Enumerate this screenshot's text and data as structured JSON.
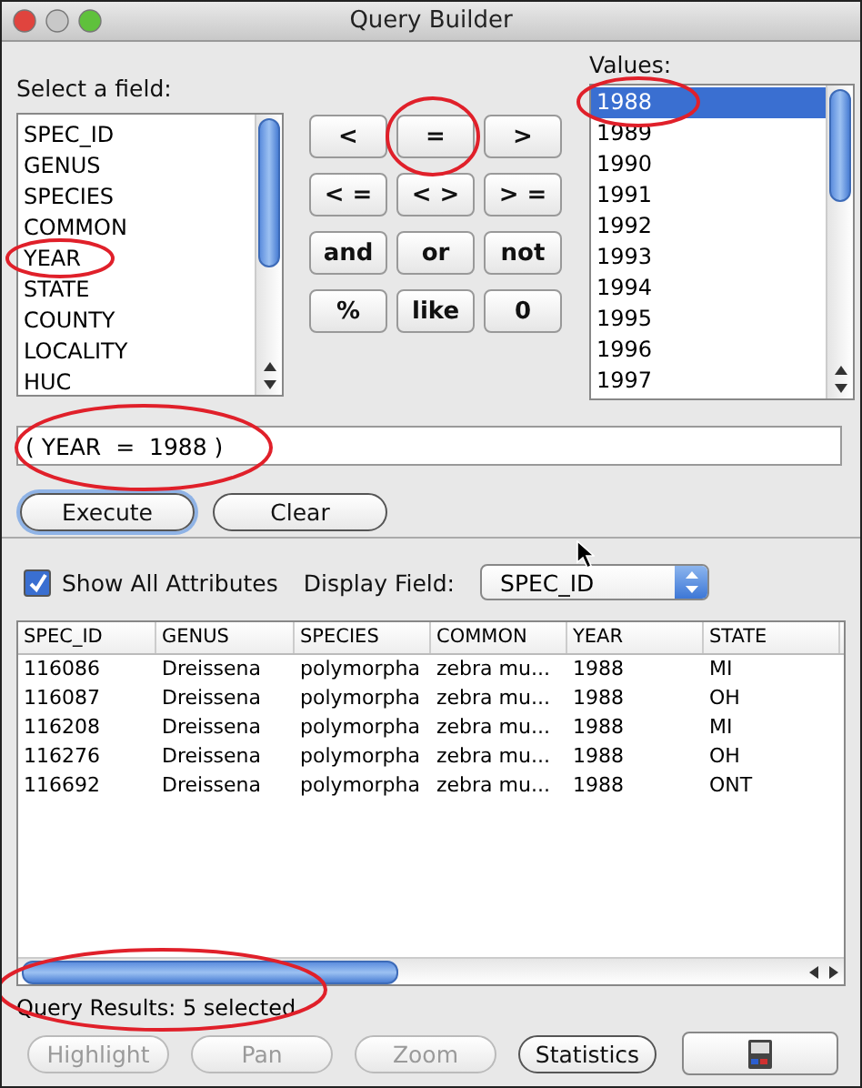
{
  "window": {
    "title": "Query Builder"
  },
  "field_list": {
    "label": "Select a field:",
    "items": [
      {
        "text": "SPEC_ID",
        "selected": false
      },
      {
        "text": "GENUS",
        "selected": false
      },
      {
        "text": "SPECIES",
        "selected": false
      },
      {
        "text": "COMMON",
        "selected": false
      },
      {
        "text": "YEAR",
        "selected": false
      },
      {
        "text": "STATE",
        "selected": false
      },
      {
        "text": "COUNTY",
        "selected": false
      },
      {
        "text": "LOCALITY",
        "selected": false
      },
      {
        "text": "HUC",
        "selected": false
      }
    ]
  },
  "operators": [
    "<",
    "=",
    ">",
    "< =",
    "< >",
    "> =",
    "and",
    "or",
    "not",
    "%",
    "like",
    "0"
  ],
  "values_list": {
    "label": "Values:",
    "items": [
      {
        "text": "1988",
        "selected": true
      },
      {
        "text": "1989",
        "selected": false
      },
      {
        "text": "1990",
        "selected": false
      },
      {
        "text": "1991",
        "selected": false
      },
      {
        "text": "1992",
        "selected": false
      },
      {
        "text": "1993",
        "selected": false
      },
      {
        "text": "1994",
        "selected": false
      },
      {
        "text": "1995",
        "selected": false
      },
      {
        "text": "1996",
        "selected": false
      },
      {
        "text": "1997",
        "selected": false
      }
    ]
  },
  "query": {
    "value": "( YEAR  =  1988 )"
  },
  "actions": [
    {
      "label": "Execute",
      "default": true
    },
    {
      "label": "Clear",
      "default": false
    }
  ],
  "show_all_attributes": {
    "label": "Show All Attributes",
    "checked": true
  },
  "display_field": {
    "label": "Display Field:",
    "value": "SPEC_ID"
  },
  "table": {
    "columns": [
      "SPEC_ID",
      "GENUS",
      "SPECIES",
      "COMMON",
      "YEAR",
      "STATE"
    ],
    "rows": [
      [
        "116086",
        "Dreissena",
        "polymorpha",
        "zebra mu...",
        "1988",
        "MI"
      ],
      [
        "116087",
        "Dreissena",
        "polymorpha",
        "zebra mu...",
        "1988",
        "OH"
      ],
      [
        "116208",
        "Dreissena",
        "polymorpha",
        "zebra mu...",
        "1988",
        "MI"
      ],
      [
        "116276",
        "Dreissena",
        "polymorpha",
        "zebra mu...",
        "1988",
        "OH"
      ],
      [
        "116692",
        "Dreissena",
        "polymorpha",
        "zebra mu...",
        "1988",
        "ONT"
      ]
    ]
  },
  "status": "Query Results: 5 selected",
  "bottom_buttons": [
    {
      "kind": "text",
      "label": "Highlight",
      "disabled": true
    },
    {
      "kind": "text",
      "label": "Pan",
      "disabled": true
    },
    {
      "kind": "text",
      "label": "Zoom",
      "disabled": true
    },
    {
      "kind": "text",
      "label": "Statistics",
      "disabled": false
    },
    {
      "kind": "save",
      "disabled": false
    }
  ]
}
